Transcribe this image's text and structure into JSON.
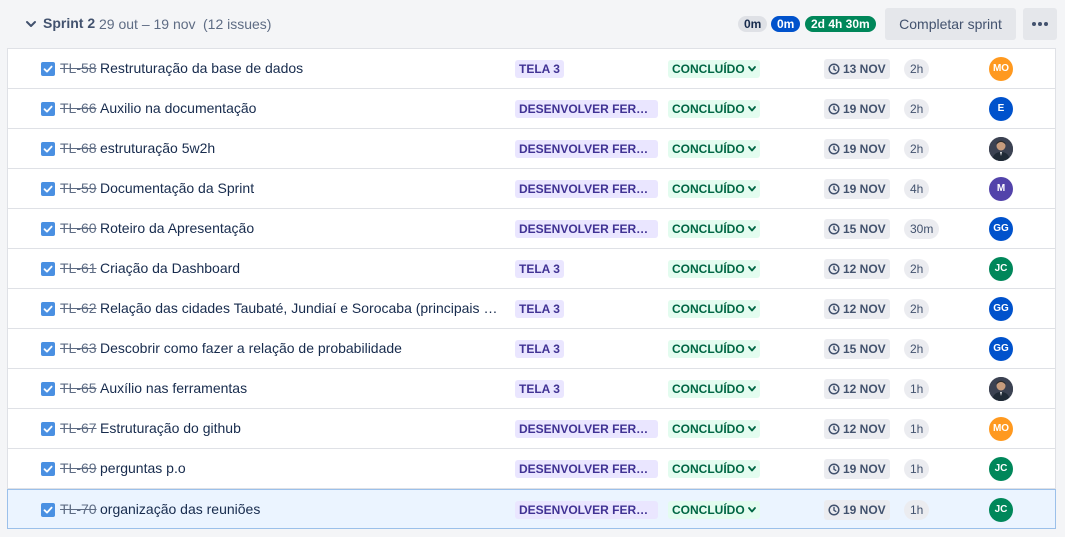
{
  "sprint": {
    "name": "Sprint 2",
    "dates": "29 out – 19 nov",
    "issue_count": "(12 issues)",
    "totals": {
      "todo": "0m",
      "in_progress": "0m",
      "done": "2d 4h 30m"
    },
    "complete_label": "Completar sprint",
    "more_icon": "more-horizontal-icon"
  },
  "colors": {
    "done_pill": "#00875a",
    "progress_pill": "#0052cc",
    "epic_bg": "#eae6ff",
    "epic_text": "#403294",
    "status_bg": "#e3fcef",
    "status_text": "#006644",
    "checkbox": "#4a90e2"
  },
  "issues": [
    {
      "key": "TL-58",
      "summary": "Restruturação da base de dados",
      "epic": "TELA 3",
      "status": "CONCLUÍDO",
      "due": "13 NOV",
      "estimate": "2h",
      "assignee": {
        "initials": "MO",
        "color": "#ff991f",
        "photo": false
      }
    },
    {
      "key": "TL-66",
      "summary": "Auxilio na documentação",
      "epic": "DESENVOLVER FERRAM...",
      "status": "CONCLUÍDO",
      "due": "19 NOV",
      "estimate": "2h",
      "assignee": {
        "initials": "E",
        "color": "#0052cc",
        "photo": false
      }
    },
    {
      "key": "TL-68",
      "summary": "estruturação 5w2h",
      "epic": "DESENVOLVER FERRAM...",
      "status": "CONCLUÍDO",
      "due": "19 NOV",
      "estimate": "2h",
      "assignee": {
        "initials": "",
        "color": "#2e3440",
        "photo": true
      }
    },
    {
      "key": "TL-59",
      "summary": "Documentação da Sprint",
      "epic": "DESENVOLVER FERRAM...",
      "status": "CONCLUÍDO",
      "due": "19 NOV",
      "estimate": "4h",
      "assignee": {
        "initials": "M",
        "color": "#5243aa",
        "photo": false
      }
    },
    {
      "key": "TL-60",
      "summary": "Roteiro da Apresentação",
      "epic": "DESENVOLVER FERRAM...",
      "status": "CONCLUÍDO",
      "due": "15 NOV",
      "estimate": "30m",
      "assignee": {
        "initials": "GG",
        "color": "#0052cc",
        "photo": false
      }
    },
    {
      "key": "TL-61",
      "summary": "Criação da Dashboard",
      "epic": "TELA 3",
      "status": "CONCLUÍDO",
      "due": "12 NOV",
      "estimate": "2h",
      "assignee": {
        "initials": "JC",
        "color": "#00875a",
        "photo": false
      }
    },
    {
      "key": "TL-62",
      "summary": "Relação das cidades Taubaté, Jundiaí e Sorocaba (principais pro...",
      "epic": "TELA 3",
      "status": "CONCLUÍDO",
      "due": "12 NOV",
      "estimate": "2h",
      "assignee": {
        "initials": "GG",
        "color": "#0052cc",
        "photo": false
      }
    },
    {
      "key": "TL-63",
      "summary": "Descobrir como fazer a relação de probabilidade",
      "epic": "TELA 3",
      "status": "CONCLUÍDO",
      "due": "15 NOV",
      "estimate": "2h",
      "assignee": {
        "initials": "GG",
        "color": "#0052cc",
        "photo": false
      }
    },
    {
      "key": "TL-65",
      "summary": "Auxílio nas ferramentas",
      "epic": "TELA 3",
      "status": "CONCLUÍDO",
      "due": "12 NOV",
      "estimate": "1h",
      "assignee": {
        "initials": "",
        "color": "#2e3440",
        "photo": true
      }
    },
    {
      "key": "TL-67",
      "summary": "Estruturação do github",
      "epic": "DESENVOLVER FERRAM...",
      "status": "CONCLUÍDO",
      "due": "12 NOV",
      "estimate": "1h",
      "assignee": {
        "initials": "MO",
        "color": "#ff991f",
        "photo": false
      }
    },
    {
      "key": "TL-69",
      "summary": "perguntas p.o",
      "epic": "DESENVOLVER FERRAM...",
      "status": "CONCLUÍDO",
      "due": "19 NOV",
      "estimate": "1h",
      "assignee": {
        "initials": "JC",
        "color": "#00875a",
        "photo": false
      }
    },
    {
      "key": "TL-70",
      "summary": "organização das reuniões",
      "epic": "DESENVOLVER FERRAM...",
      "status": "CONCLUÍDO",
      "due": "19 NOV",
      "estimate": "1h",
      "assignee": {
        "initials": "JC",
        "color": "#00875a",
        "photo": false
      }
    }
  ]
}
